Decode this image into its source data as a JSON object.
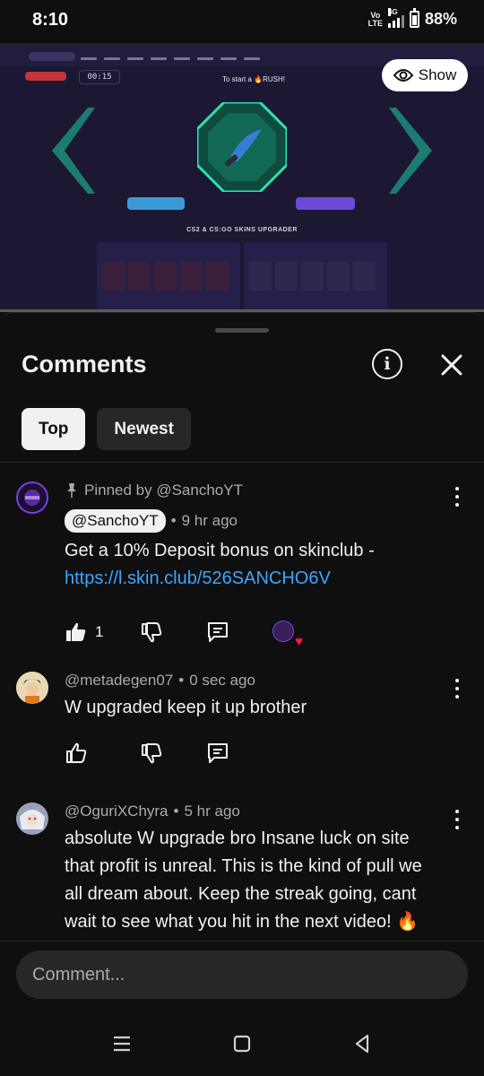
{
  "status_bar": {
    "time": "8:10",
    "volte_top": "Vo",
    "volte_bottom": "LTE",
    "network": "4G",
    "battery": "88%",
    "battery_level": 0.88
  },
  "video": {
    "timer": "00:15",
    "headline": "To start a 🔥RUSH!",
    "caption": "CS2 & CS:GO SKINS UPGRADER",
    "show_label": "Show",
    "icons": {
      "eye": "eye-icon"
    }
  },
  "sheet": {
    "title": "Comments",
    "icons": {
      "info": "info-icon",
      "close": "close-icon"
    }
  },
  "chips": [
    {
      "label": "Top",
      "active": true
    },
    {
      "label": "Newest",
      "active": false
    }
  ],
  "comments": [
    {
      "pinned": "Pinned by @SanchoYT",
      "author": "@SanchoYT",
      "time": "9 hr ago",
      "text": "Get a 10% Deposit bonus on skinclub -",
      "link": "https://l.skin.club/526SANCHO6V",
      "likes": "1",
      "creator_heart": true
    },
    {
      "author": "@metadegen07",
      "time": "0 sec ago",
      "text": "W upgraded keep it up brother",
      "likes": ""
    },
    {
      "author": "@OguriXChyra",
      "time": "5 hr ago",
      "text": "absolute W upgrade bro Insane luck on site that profit is unreal. This is the kind of pull we all dream about. Keep the streak going, cant wait to see what you hit in the next video! 🔥",
      "likes": ""
    }
  ],
  "comment_input": {
    "placeholder": "Comment..."
  },
  "accent": {
    "link": "#3ea6ff",
    "heart": "#ff1744",
    "background": "#0f0f0f"
  }
}
